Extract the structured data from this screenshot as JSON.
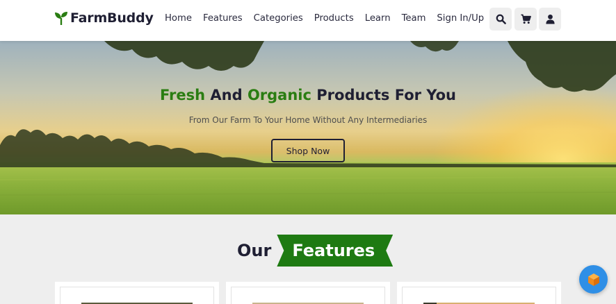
{
  "brand": {
    "name": "FarmBuddy",
    "logo_icon": "sprout-icon",
    "accent": "#2a7d12"
  },
  "nav": [
    {
      "label": "Home"
    },
    {
      "label": "Features"
    },
    {
      "label": "Categories"
    },
    {
      "label": "Products"
    },
    {
      "label": "Learn"
    },
    {
      "label": "Team"
    },
    {
      "label": "Sign In/Up"
    }
  ],
  "header_icons": [
    "search-icon",
    "cart-icon",
    "user-icon"
  ],
  "hero": {
    "title_part1": "Fresh",
    "title_part2": " And ",
    "title_part3": "Organic",
    "title_part4": " Products For You",
    "subtitle": "From Our Farm To Your Home Without Any Intermediaries",
    "cta": "Shop Now"
  },
  "features": {
    "heading_prefix": "Our",
    "heading_highlight": "Features",
    "banner_color": "#1e7a12"
  },
  "feature_cards": [
    {},
    {},
    {}
  ],
  "floating_button": {
    "icon": "cube-icon",
    "color": "#2f8fe6"
  }
}
